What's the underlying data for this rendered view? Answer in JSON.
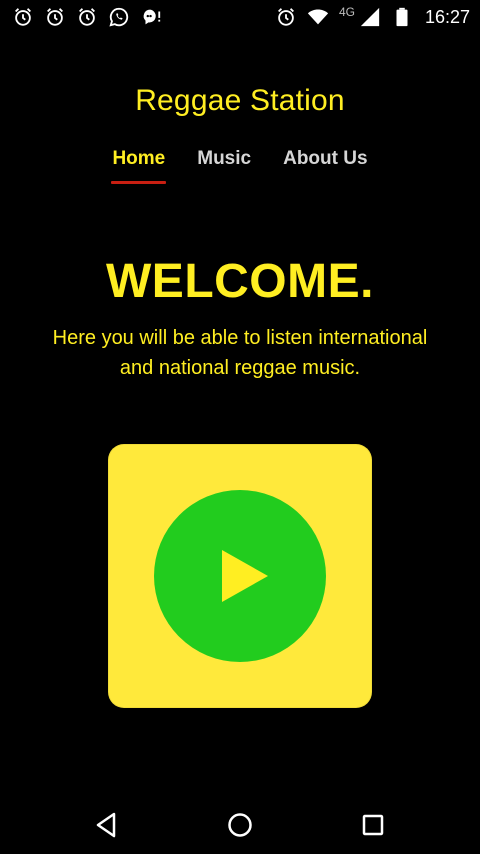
{
  "status_bar": {
    "left_icons": [
      "alarm-icon",
      "alarm-icon",
      "alarm-icon",
      "whatsapp-icon",
      "notification-bubble-icon"
    ],
    "right_icons": [
      "alarm-icon",
      "wifi-icon",
      "cell-signal-icon",
      "battery-icon"
    ],
    "network_type": "4G",
    "time": "16:27"
  },
  "app": {
    "title": "Reggae Station"
  },
  "nav": {
    "items": [
      {
        "label": "Home",
        "active": true
      },
      {
        "label": "Music",
        "active": false
      },
      {
        "label": "About Us",
        "active": false
      }
    ]
  },
  "welcome": {
    "heading": "WELCOME.",
    "line1": "Here you will be able to listen international",
    "line2": "and national reggae music."
  },
  "player": {
    "icon": "play-icon"
  },
  "system_nav": {
    "icons": [
      "back-icon",
      "home-icon",
      "recents-icon"
    ]
  },
  "colors": {
    "background": "#000000",
    "accent_yellow": "#ffee22",
    "tile_yellow": "#ffe93b",
    "play_green": "#22cc1e",
    "active_underline": "#c81f12",
    "inactive_nav": "#d6d6d6"
  }
}
